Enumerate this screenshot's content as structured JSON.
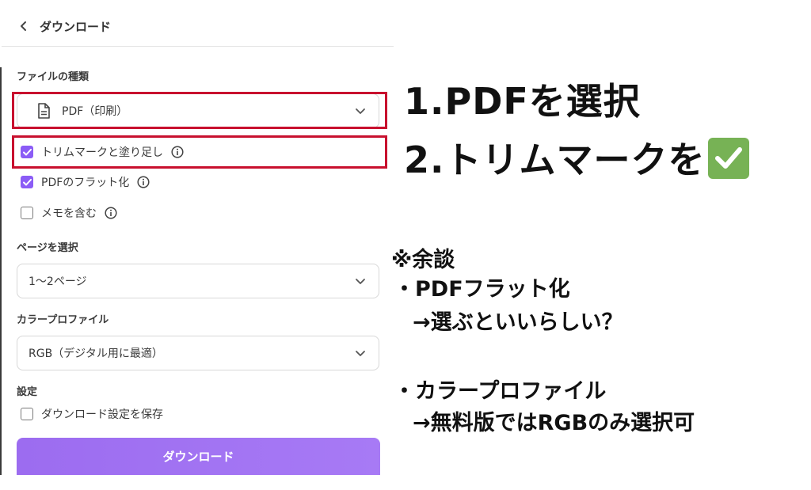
{
  "header": {
    "title": "ダウンロード"
  },
  "file_type": {
    "label": "ファイルの種類",
    "selected": "PDF（印刷）"
  },
  "options": [
    {
      "label": "トリムマークと塗り足し",
      "checked": true
    },
    {
      "label": "PDFのフラット化",
      "checked": true
    },
    {
      "label": "メモを含む",
      "checked": false
    }
  ],
  "pages": {
    "label": "ページを選択",
    "selected": "1〜2ページ"
  },
  "color_profile": {
    "label": "カラープロファイル",
    "selected": "RGB（デジタル用に最適）"
  },
  "settings": {
    "label": "設定",
    "save_label": "ダウンロード設定を保存",
    "checked": false
  },
  "download_button": "ダウンロード",
  "annotations": {
    "step1": "1.PDFを選択",
    "step2": "2.トリムマークを",
    "note_title": "※余談",
    "note1": "・PDFフラット化",
    "note1_sub": "→選ぶといいらしい？",
    "note2": "・カラープロファイル",
    "note2_sub": "→無料版ではRGBのみ選択可"
  },
  "colors": {
    "accent": "#8b5cf6",
    "highlight": "#c8102e",
    "check_emoji": "#77b255"
  }
}
